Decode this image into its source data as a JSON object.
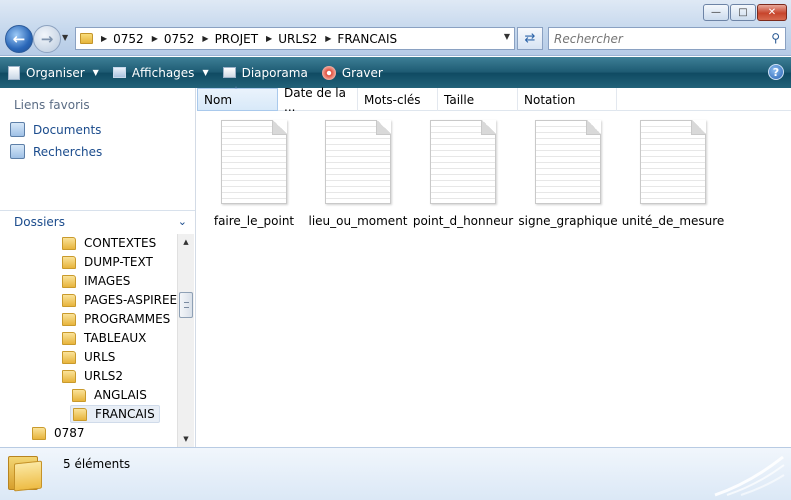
{
  "window": {
    "minimize_icon": "minimize-icon",
    "maximize_icon": "maximize-icon",
    "close_icon": "close-icon"
  },
  "address": {
    "crumbs": [
      "0752",
      "0752",
      "PROJET",
      "URLS2",
      "FRANCAIS"
    ]
  },
  "search": {
    "placeholder": "Rechercher"
  },
  "toolbar": {
    "organiser": "Organiser",
    "affichages": "Affichages",
    "diaporama": "Diaporama",
    "graver": "Graver",
    "help": "?"
  },
  "favorites": {
    "title": "Liens favoris",
    "items": [
      "Documents",
      "Recherches"
    ]
  },
  "folders": {
    "title": "Dossiers",
    "items": [
      "CONTEXTES",
      "DUMP-TEXT",
      "IMAGES",
      "PAGES-ASPIREES",
      "PROGRAMMES",
      "TABLEAUX",
      "URLS",
      "URLS2",
      "ANGLAIS",
      "FRANCAIS",
      "0787"
    ]
  },
  "columns": [
    "Nom",
    "Date de la ...",
    "Mots-clés",
    "Taille",
    "Notation"
  ],
  "files": [
    "faire_le_point",
    "lieu_ou_moment",
    "point_d_honneur",
    "signe_graphique",
    "unité_de_mesure"
  ],
  "status": {
    "count": "5 éléments"
  },
  "colors": {
    "command_bar": "#1d5a72",
    "link": "#1a4b8c",
    "title_gradient": "#c3d6ec"
  }
}
